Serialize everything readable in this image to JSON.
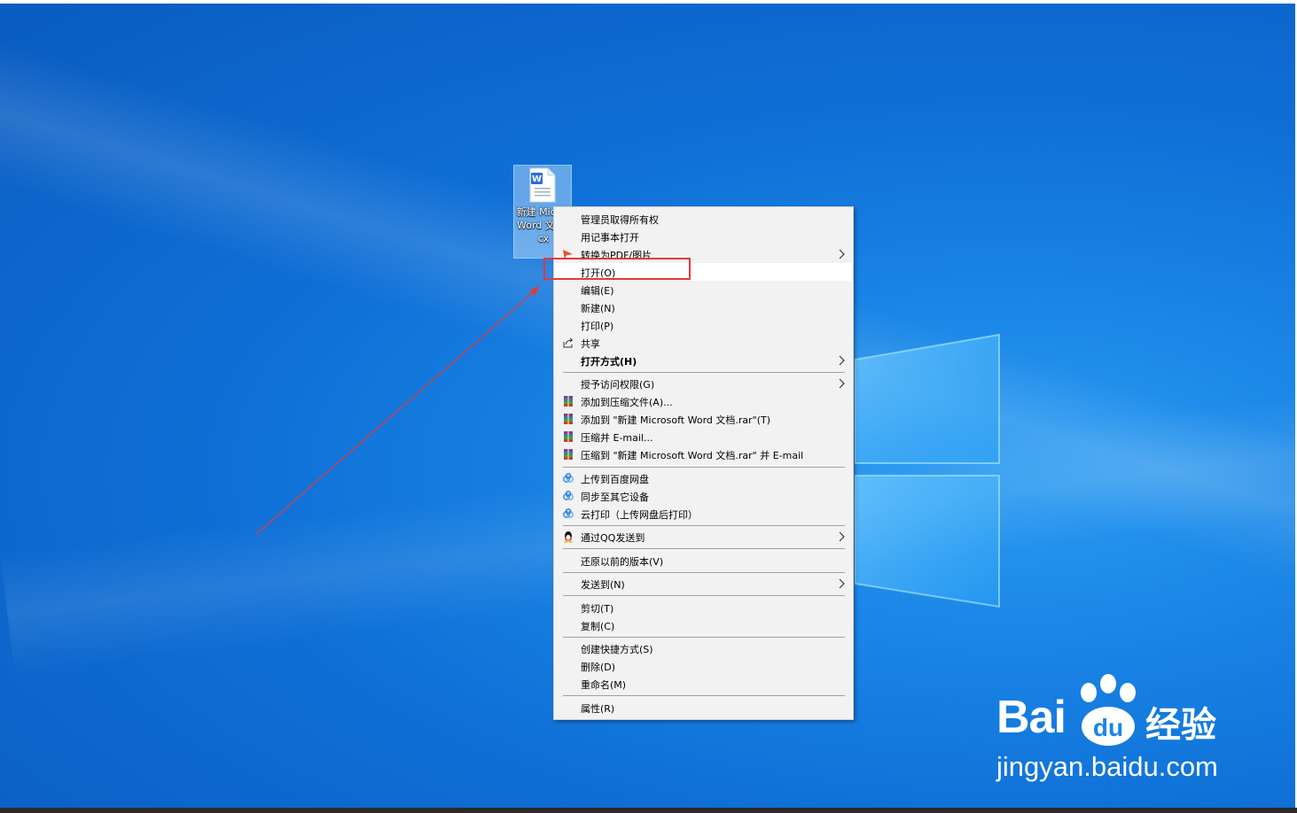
{
  "desktop_icon": {
    "label": "新建 Micros Word 文 docx",
    "icon": "word-document-icon"
  },
  "context_menu": {
    "items": [
      {
        "label": "管理员取得所有权",
        "icon": "",
        "submenu": false
      },
      {
        "label": "用记事本打开",
        "icon": "",
        "submenu": false
      },
      {
        "label": "转换为PDF/图片",
        "icon": "pdf-convert-icon",
        "submenu": true
      },
      {
        "label": "打开(O)",
        "icon": "",
        "submenu": false,
        "highlighted": true
      },
      {
        "label": "编辑(E)",
        "icon": "",
        "submenu": false
      },
      {
        "label": "新建(N)",
        "icon": "",
        "submenu": false
      },
      {
        "label": "打印(P)",
        "icon": "",
        "submenu": false
      },
      {
        "label": "共享",
        "icon": "share-icon",
        "submenu": false
      },
      {
        "label": "打开方式(H)",
        "icon": "",
        "submenu": true,
        "bold": true
      },
      {
        "label": "授予访问权限(G)",
        "icon": "",
        "submenu": true
      },
      {
        "label": "添加到压缩文件(A)...",
        "icon": "winrar-icon",
        "submenu": false
      },
      {
        "label": "添加到 \"新建 Microsoft Word 文档.rar\"(T)",
        "icon": "winrar-icon",
        "submenu": false
      },
      {
        "label": "压缩并 E-mail...",
        "icon": "winrar-icon",
        "submenu": false
      },
      {
        "label": "压缩到 \"新建 Microsoft Word 文档.rar\" 并 E-mail",
        "icon": "winrar-icon",
        "submenu": false
      },
      {
        "label": "上传到百度网盘",
        "icon": "baidu-netdisk-icon",
        "submenu": false
      },
      {
        "label": "同步至其它设备",
        "icon": "baidu-netdisk-icon",
        "submenu": false
      },
      {
        "label": "云打印（上传网盘后打印）",
        "icon": "baidu-netdisk-icon",
        "submenu": false
      },
      {
        "label": "通过QQ发送到",
        "icon": "qq-icon",
        "submenu": true
      },
      {
        "label": "还原以前的版本(V)",
        "icon": "",
        "submenu": false
      },
      {
        "label": "发送到(N)",
        "icon": "",
        "submenu": true
      },
      {
        "label": "剪切(T)",
        "icon": "",
        "submenu": false
      },
      {
        "label": "复制(C)",
        "icon": "",
        "submenu": false
      },
      {
        "label": "创建快捷方式(S)",
        "icon": "",
        "submenu": false
      },
      {
        "label": "删除(D)",
        "icon": "",
        "submenu": false
      },
      {
        "label": "重命名(M)",
        "icon": "",
        "submenu": false
      },
      {
        "label": "属性(R)",
        "icon": "",
        "submenu": false
      }
    ]
  },
  "watermark": {
    "brand": "Bai",
    "brand_suffix": "经验",
    "url": "jingyan.baidu.com"
  },
  "colors": {
    "desktop_blue": "#0f6fd6",
    "menu_bg": "#f2f2f2",
    "annotation_red": "#e33a3a"
  }
}
